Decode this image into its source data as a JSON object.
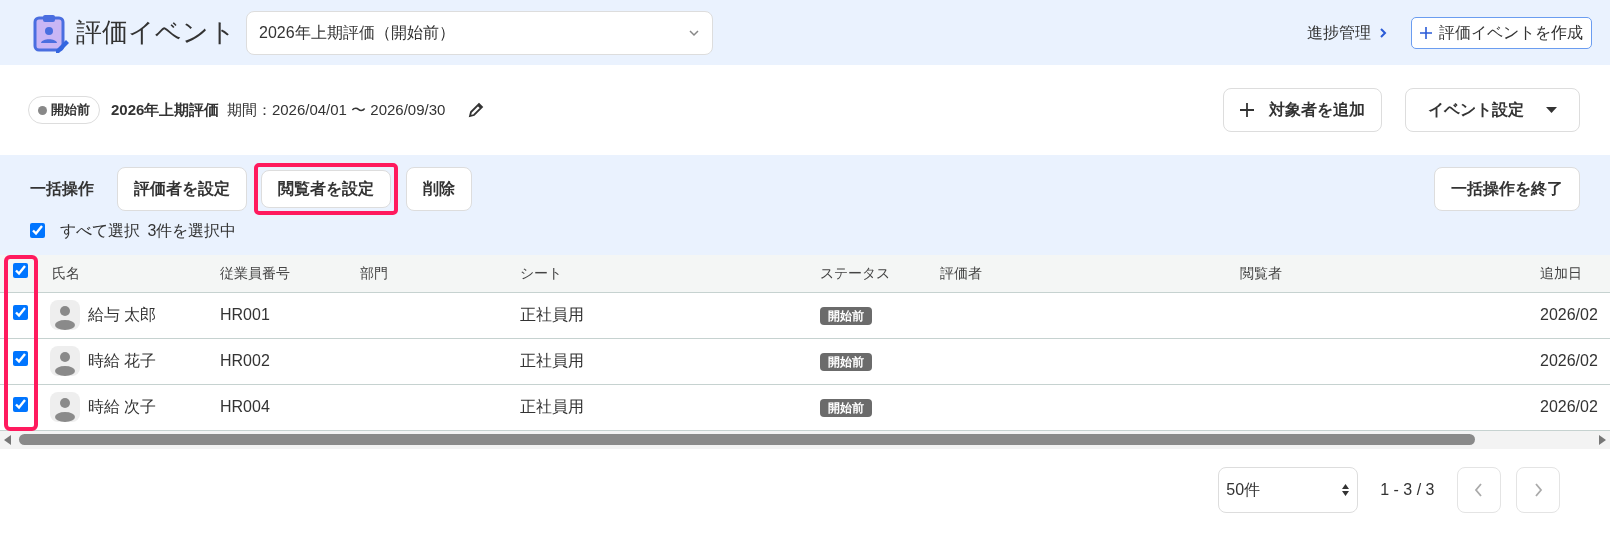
{
  "header": {
    "title": "評価イベント",
    "event_select": {
      "value": "2026年上期評価（開始前）"
    },
    "progress_link": "進捗管理",
    "create_button": "評価イベントを作成"
  },
  "event": {
    "status": "開始前",
    "name": "2026年上期評価",
    "period": "期間：2026/04/01 〜 2026/09/30",
    "add_button": "対象者を追加",
    "settings_button": "イベント設定"
  },
  "bulk": {
    "label": "一括操作",
    "buttons": [
      {
        "label": "評価者を設定",
        "highlighted": false
      },
      {
        "label": "閲覧者を設定",
        "highlighted": true
      },
      {
        "label": "削除",
        "highlighted": false
      }
    ],
    "end_button": "一括操作を終了",
    "select_all": {
      "label": "すべて選択",
      "checked": true
    },
    "selected_count": "3件を選択中"
  },
  "table": {
    "checkbox_column_highlighted": true,
    "all_checked": true,
    "columns": [
      "氏名",
      "従業員番号",
      "部門",
      "シート",
      "ステータス",
      "評価者",
      "閲覧者",
      "追加日"
    ],
    "rows": [
      {
        "checked": true,
        "name": "給与 太郎",
        "employee_no": "HR001",
        "sheet": "正社員用",
        "status": "開始前",
        "added": "2026/02"
      },
      {
        "checked": true,
        "name": "時給 花子",
        "employee_no": "HR002",
        "sheet": "正社員用",
        "status": "開始前",
        "added": "2026/02"
      },
      {
        "checked": true,
        "name": "時給 次子",
        "employee_no": "HR004",
        "sheet": "正社員用",
        "status": "開始前",
        "added": "2026/02"
      }
    ]
  },
  "pagination": {
    "page_size": "50件",
    "range": "1 - 3 / 3",
    "prev_disabled": true,
    "next_disabled": true
  }
}
